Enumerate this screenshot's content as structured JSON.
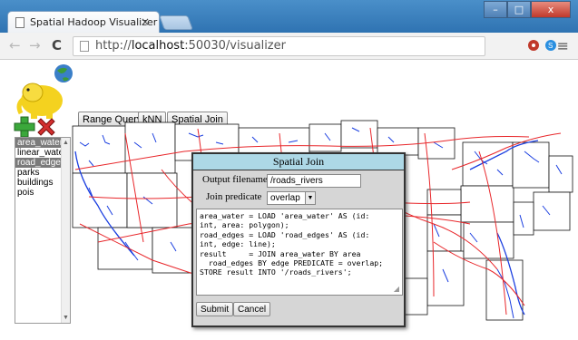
{
  "browser": {
    "tab_title": "Spatial Hadoop Visualizer",
    "tab_close": "×",
    "url_protocol": "http://",
    "url_host": "localhost",
    "url_path": ":50030/visualizer",
    "nav_back": "←",
    "nav_forward": "→",
    "nav_reload": "C",
    "menu": "≡",
    "window_min": "–",
    "window_max": "□",
    "window_close": "x"
  },
  "toolbar": {
    "range_query": "Range Query",
    "knn": "kNN",
    "spatial_join": "Spatial Join"
  },
  "layers": {
    "items": [
      "area_water",
      "linear_water",
      "road_edges",
      "parks",
      "buildings",
      "pois"
    ],
    "selected": [
      "area_water",
      "road_edges"
    ]
  },
  "dialog": {
    "title": "Spatial Join",
    "output_label": "Output filename",
    "output_value": "/roads_rivers",
    "predicate_label": "Join predicate",
    "predicate_value": "overlap",
    "script": "area_water = LOAD 'area_water' AS (id:\nint, area: polygon);\nroad_edges = LOAD 'road_edges' AS (id:\nint, edge: line);\nresult     = JOIN area_water BY area\n  road_edges BY edge PREDICATE = overlap;\nSTORE result INTO '/roads_rivers';",
    "submit": "Submit",
    "cancel": "Cancel"
  },
  "colors": {
    "titlebar": "#3b7fbf",
    "dialog_header": "#add8e6",
    "road": "#e8262a",
    "water": "#1a3ee0",
    "selected_layer": "#7a7a7a"
  }
}
